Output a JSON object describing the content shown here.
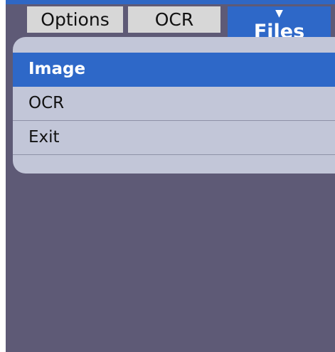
{
  "tabs": {
    "options": "Options",
    "ocr": "OCR",
    "files": "Files",
    "files_arrow": "▼"
  },
  "menu": {
    "items": [
      {
        "label": "Image",
        "selected": true
      },
      {
        "label": "OCR",
        "selected": false
      },
      {
        "label": "Exit",
        "selected": false
      }
    ]
  },
  "colors": {
    "accent": "#2e68c8",
    "background": "#5e5a76",
    "menu_bg": "#c2c6d8",
    "tab_bg": "#d7d7d7"
  }
}
